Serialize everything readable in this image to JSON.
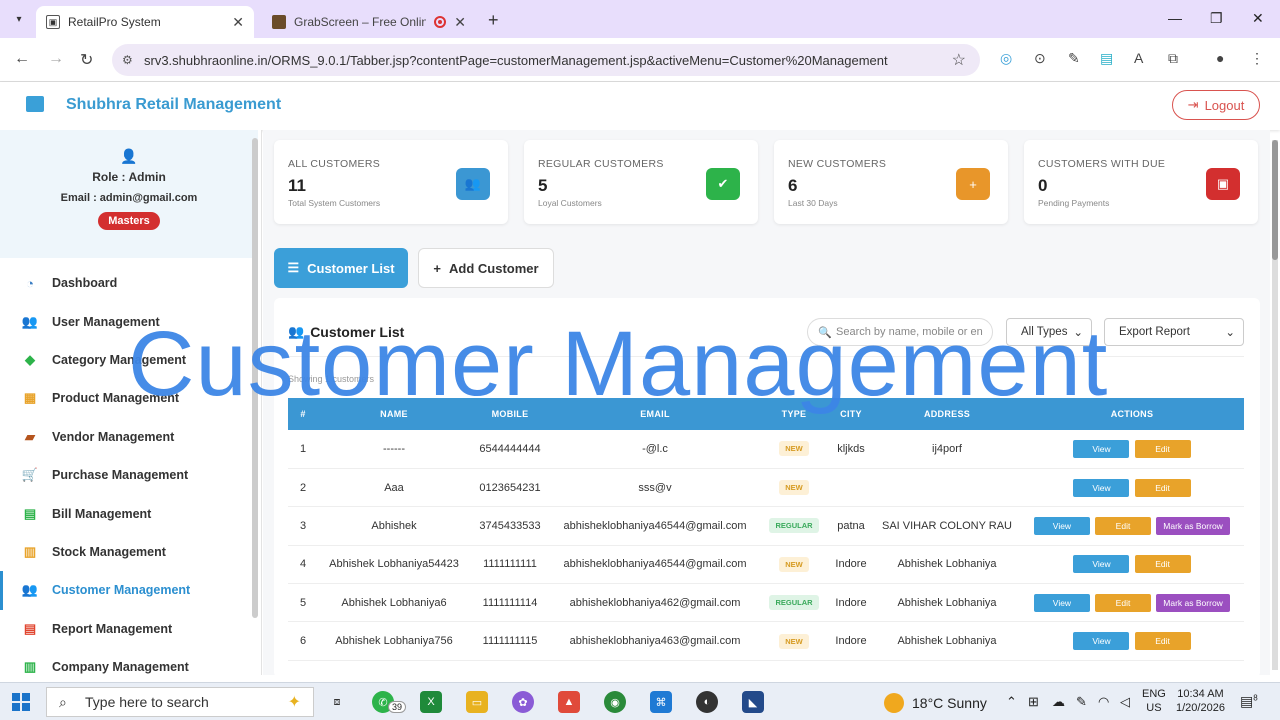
{
  "browser": {
    "tabs": [
      {
        "title": "RetailPro System"
      },
      {
        "title": "GrabScreen – Free Online S"
      }
    ],
    "url": "srv3.shubhraonline.in/ORMS_9.0.1/Tabber.jsp?contentPage=customerManagement.jsp&activeMenu=Customer%20Management"
  },
  "header": {
    "brand": "Shubhra Retail Management",
    "logout": "Logout"
  },
  "profile": {
    "role": "Role : Admin",
    "email": "Email : admin@gmail.com",
    "badge": "Masters"
  },
  "sidebar": {
    "items": [
      {
        "label": "Dashboard",
        "icon": "dashboard-icon",
        "color": "#3b7fc4"
      },
      {
        "label": "User Management",
        "icon": "users-icon",
        "color": "#e0452f"
      },
      {
        "label": "Category Management",
        "icon": "tag-icon",
        "color": "#2db34a"
      },
      {
        "label": "Product Management",
        "icon": "boxes-icon",
        "color": "#e8a32a"
      },
      {
        "label": "Vendor Management",
        "icon": "truck-icon",
        "color": "#b5541d"
      },
      {
        "label": "Purchase Management",
        "icon": "cart-icon",
        "color": "#e0452f"
      },
      {
        "label": "Bill Management",
        "icon": "bill-icon",
        "color": "#2db34a"
      },
      {
        "label": "Stock Management",
        "icon": "warehouse-icon",
        "color": "#e8a32a"
      },
      {
        "label": "Customer Management",
        "icon": "customers-icon",
        "color": "#3b9fd9"
      },
      {
        "label": "Report Management",
        "icon": "report-icon",
        "color": "#e0452f"
      },
      {
        "label": "Company Management",
        "icon": "company-icon",
        "color": "#2db34a"
      }
    ],
    "active": "Customer Management"
  },
  "stats": [
    {
      "label": "ALL CUSTOMERS",
      "value": "11",
      "sub": "Total System Customers",
      "color": "#3b97d3"
    },
    {
      "label": "REGULAR CUSTOMERS",
      "value": "5",
      "sub": "Loyal Customers",
      "color": "#2db34a"
    },
    {
      "label": "NEW CUSTOMERS",
      "value": "6",
      "sub": "Last 30 Days",
      "color": "#e8962a"
    },
    {
      "label": "CUSTOMERS WITH DUE",
      "value": "0",
      "sub": "Pending Payments",
      "color": "#d32f2f"
    }
  ],
  "actions": {
    "customer_list": "Customer List",
    "add_customer": "Add Customer"
  },
  "panel": {
    "title": "Customer List",
    "showing": "Showing 1 customers",
    "search_placeholder": "Search by name, mobile or en",
    "type_filter": "All Types",
    "export": "Export Report"
  },
  "table": {
    "headers": [
      "#",
      "NAME",
      "MOBILE",
      "EMAIL",
      "TYPE",
      "CITY",
      "ADDRESS",
      "ACTIONS"
    ],
    "rows": [
      {
        "idx": "1",
        "name": "------",
        "mobile": "6544444444",
        "email": "-@l.c",
        "type": "NEW",
        "city": "kljkds",
        "address": "ij4porf",
        "borrow": false
      },
      {
        "idx": "2",
        "name": "Aaa",
        "mobile": "0123654231",
        "email": "sss@v",
        "type": "NEW",
        "city": "",
        "address": "",
        "borrow": false
      },
      {
        "idx": "3",
        "name": "Abhishek",
        "mobile": "3745433533",
        "email": "abhisheklobhaniya46544@gmail.com",
        "type": "REGULAR",
        "city": "patna",
        "address": "SAI VIHAR COLONY RAU",
        "borrow": true
      },
      {
        "idx": "4",
        "name": "Abhishek Lobhaniya54423",
        "mobile": "1111111111",
        "email": "abhisheklobhaniya46544@gmail.com",
        "type": "NEW",
        "city": "Indore",
        "address": "Abhishek Lobhaniya",
        "borrow": false
      },
      {
        "idx": "5",
        "name": "Abhishek Lobhaniya6",
        "mobile": "1111111114",
        "email": "abhisheklobhaniya462@gmail.com",
        "type": "REGULAR",
        "city": "Indore",
        "address": "Abhishek Lobhaniya",
        "borrow": true
      },
      {
        "idx": "6",
        "name": "Abhishek Lobhaniya756",
        "mobile": "1111111115",
        "email": "abhisheklobhaniya463@gmail.com",
        "type": "NEW",
        "city": "Indore",
        "address": "Abhishek Lobhaniya",
        "borrow": false
      }
    ],
    "view_label": "View",
    "edit_label": "Edit",
    "borrow_label": "Mark as Borrow"
  },
  "overlay_text": "Customer Management",
  "taskbar": {
    "search_placeholder": "Type here to search",
    "whatsapp_badge": "39",
    "weather": "18°C  Sunny",
    "lang_top": "ENG",
    "lang_bottom": "US",
    "time": "10:34 AM",
    "date": "1/20/2026",
    "notif_count": "8"
  }
}
